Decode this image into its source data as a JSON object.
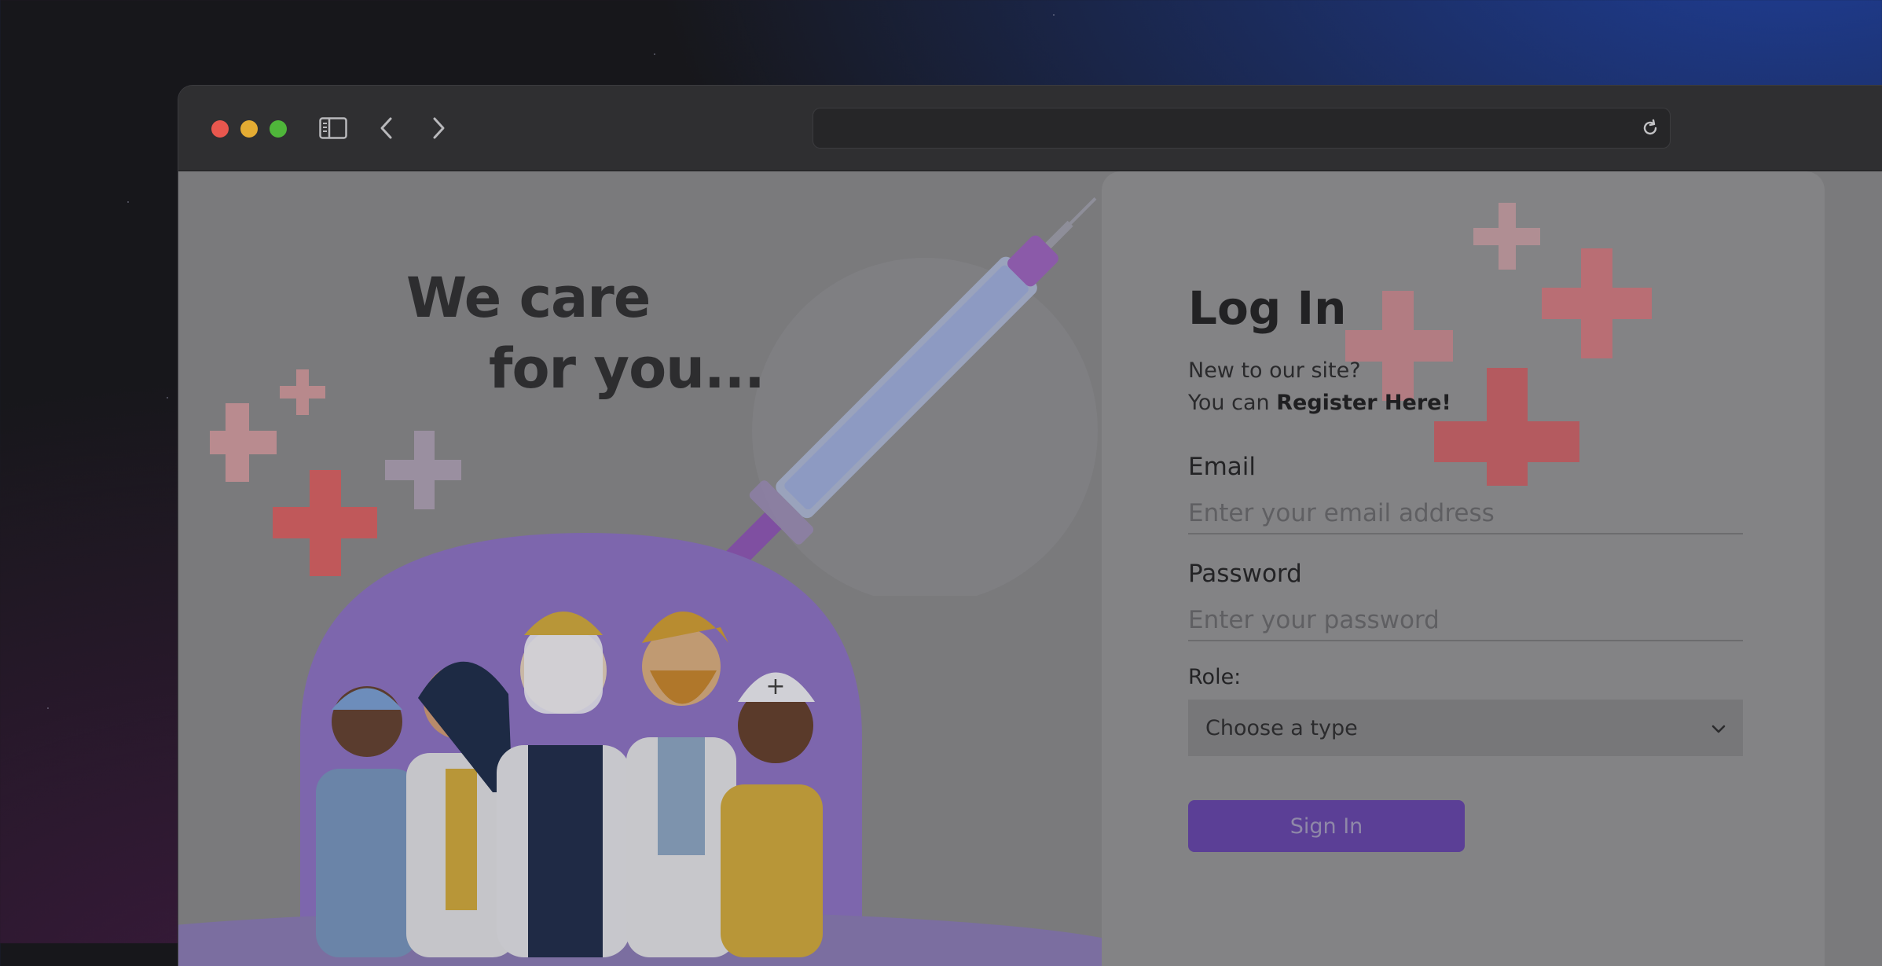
{
  "window": {
    "url": ""
  },
  "hero": {
    "headline_line1": "We care",
    "headline_line2": "for you..."
  },
  "login": {
    "title": "Log In",
    "prompt": "New to our site?",
    "register_prefix": "You can ",
    "register_link": "Register Here!",
    "email_label": "Email",
    "email_placeholder": "Enter your email address",
    "password_label": "Password",
    "password_placeholder": "Enter your password",
    "role_label": "Role:",
    "role_selected": "Choose a type",
    "submit_label": "Sign In"
  },
  "icons": {
    "traffic_lights": [
      "close-icon",
      "minimize-icon",
      "maximize-icon"
    ],
    "toolbar": [
      "sidebar-toggle-icon",
      "back-icon",
      "forward-icon",
      "reload-icon"
    ],
    "illustration": [
      "syringe-illustration",
      "medical-cross-icon",
      "healthcare-workers-illustration"
    ]
  },
  "colors": {
    "accent": "#5b3f96",
    "cross_red": "#c85a5e",
    "cross_pink": "#b8898c",
    "illustration_purple": "#8a6fc0"
  }
}
